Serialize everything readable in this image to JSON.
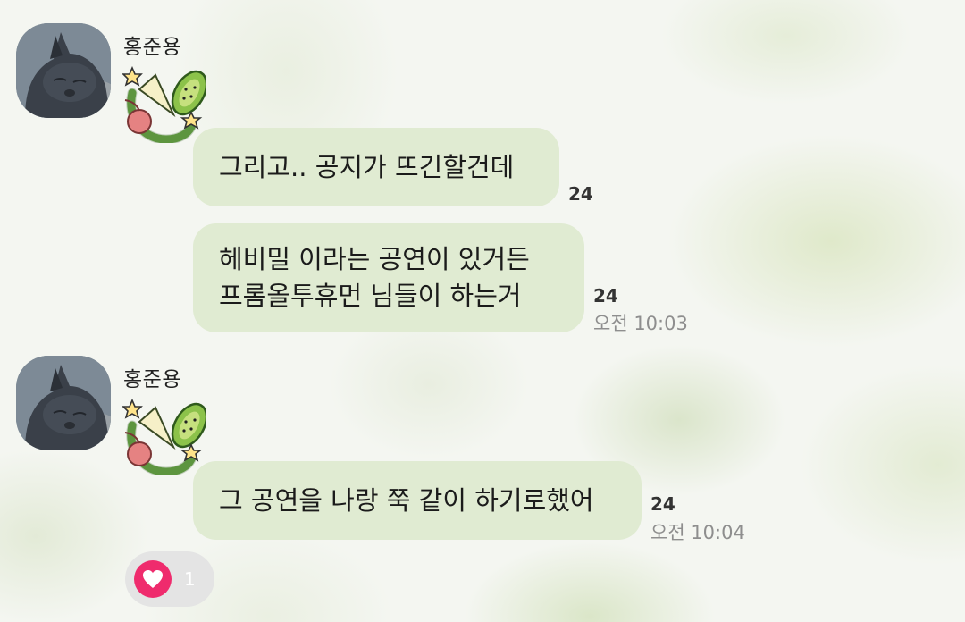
{
  "messages": [
    {
      "sender": "홍준용",
      "bubbles": [
        {
          "text": "그리고.. 공지가 뜨긴할건데",
          "unread": "24",
          "time": ""
        },
        {
          "text": "헤비밀 이라는 공연이 있거든\n프롬올투휴먼 님들이 하는거",
          "unread": "24",
          "time": "오전 10:03"
        }
      ]
    },
    {
      "sender": "홍준용",
      "bubbles": [
        {
          "text": "그 공연을 나랑 쭉 같이 하기로했어",
          "unread": "24",
          "time": "오전 10:04"
        }
      ]
    }
  ],
  "reaction": {
    "icon": "heart-icon",
    "count": "1",
    "color": "#ef2b6d"
  },
  "colors": {
    "bubble": "#e0ebd2",
    "background": "#f4f6f1"
  }
}
